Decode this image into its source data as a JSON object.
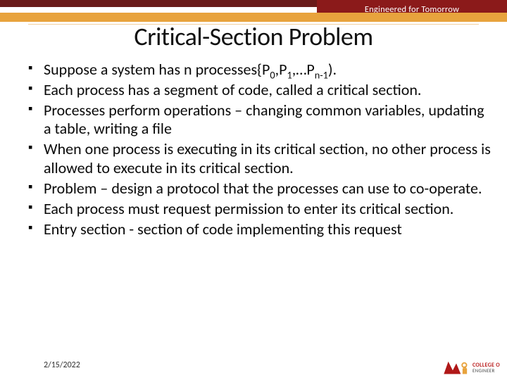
{
  "header": {
    "tagline": "Engineered for Tomorrow"
  },
  "title": "Critical-Section Problem",
  "bullets": [
    {
      "pre": "Suppose a system has n processes{P",
      "s0": "0",
      "mid1": ",P",
      "s1": "1",
      "mid2": ",…P",
      "s2": "n-1",
      "post": ")."
    },
    {
      "text": "Each process has a segment of code, called a critical section."
    },
    {
      "text": "Processes perform operations – changing common variables, updating a table, writing a file"
    },
    {
      "text": "When one process is executing in its critical section, no other process is allowed to execute in its critical section."
    },
    {
      "text": "Problem – design a protocol that the processes can use to co-operate."
    },
    {
      "text": "Each process must request permission to enter its critical section."
    },
    {
      "text": "Entry section - section of code implementing this request"
    }
  ],
  "footer": {
    "date": "2/15/2022",
    "logo_main": "COLLEGE O",
    "logo_sub": "ENGINEER"
  }
}
